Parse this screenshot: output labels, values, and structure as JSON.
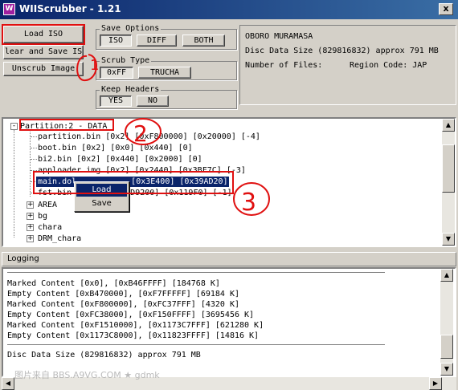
{
  "window": {
    "title": "WIIScrubber - 1.21",
    "close": "x",
    "icon": "W"
  },
  "buttons": {
    "load_iso": "Load ISO",
    "clean_save": "lear and Save IS",
    "unscrub": "Unscrub Image"
  },
  "save_options": {
    "title": "Save Options",
    "iso": "ISO",
    "diff": "DIFF",
    "both": "BOTH",
    "selected": "ISO"
  },
  "scrub_type": {
    "title": "Scrub Type",
    "oxff": "0xFF",
    "trucha": "TRUCHA",
    "selected": "0xFF"
  },
  "keep_headers": {
    "title": "Keep Headers",
    "yes": "YES",
    "no": "NO",
    "selected": "YES"
  },
  "info": {
    "game_title": "OBORO MURAMASA",
    "disc_size": "Disc Data Size (829816832) approx  791 MB",
    "num_files": "Number of Files:",
    "region": "Region Code: JAP"
  },
  "tree": {
    "partition": "Partition:2 - DATA",
    "files": [
      "partition.bin [0x2] [0xF800000] [0x20000] [-4]",
      "boot.bin [0x2] [0x0] [0x440] [0]",
      "bi2.bin [0x2] [0x440] [0x2000] [0]",
      "apploader.img [0x2] [0x2440] [0x3BF7C] [-3]",
      "main.dol [0x2] [0x3E400] [0x39AD20] [-2]",
      "fst.bin [0x2] [0x3D9200] [0x119F0] [-1]"
    ],
    "main_dol_visible": "main.dol",
    "main_dol_tail": "[0x3E400] [0x39AD20] [-2]",
    "fst_visible": "fst.bin",
    "fst_tail": "3D9200] [0x119F0] [-1]",
    "folders": [
      "AREA",
      "bg",
      "chara",
      "DRM_chara"
    ],
    "expander_collapsed": "+",
    "expander_expanded": "-"
  },
  "context_menu": {
    "load": "Load",
    "save": "Save"
  },
  "logging": {
    "title": "Logging",
    "lines": [
      "Marked Content [0x0], [0xB46FFFF] [184768 K]",
      "Empty Content [0xB470000], [0xF7FFFFF] [69184 K]",
      "Marked Content [0xF800000], [0xFC37FFF] [4320 K]",
      "Empty Content [0xFC38000], [0xF150FFFF] [3695456 K]",
      "Marked Content [0xF1510000], [0x1173C7FFF] [621280 K]",
      "Empty Content [0x1173C8000], [0x11823FFFF] [14816 K]"
    ],
    "summary": "Disc Data Size (829816832) approx  791 MB"
  },
  "annotations": {
    "one": "1",
    "two": "2",
    "three": "3"
  },
  "watermark": "图片来自 BBS.A9VG.COM ★ gdmk",
  "colors": {
    "selection": "#0a246a",
    "annotation": "#e01010",
    "face": "#d4d0c8"
  }
}
